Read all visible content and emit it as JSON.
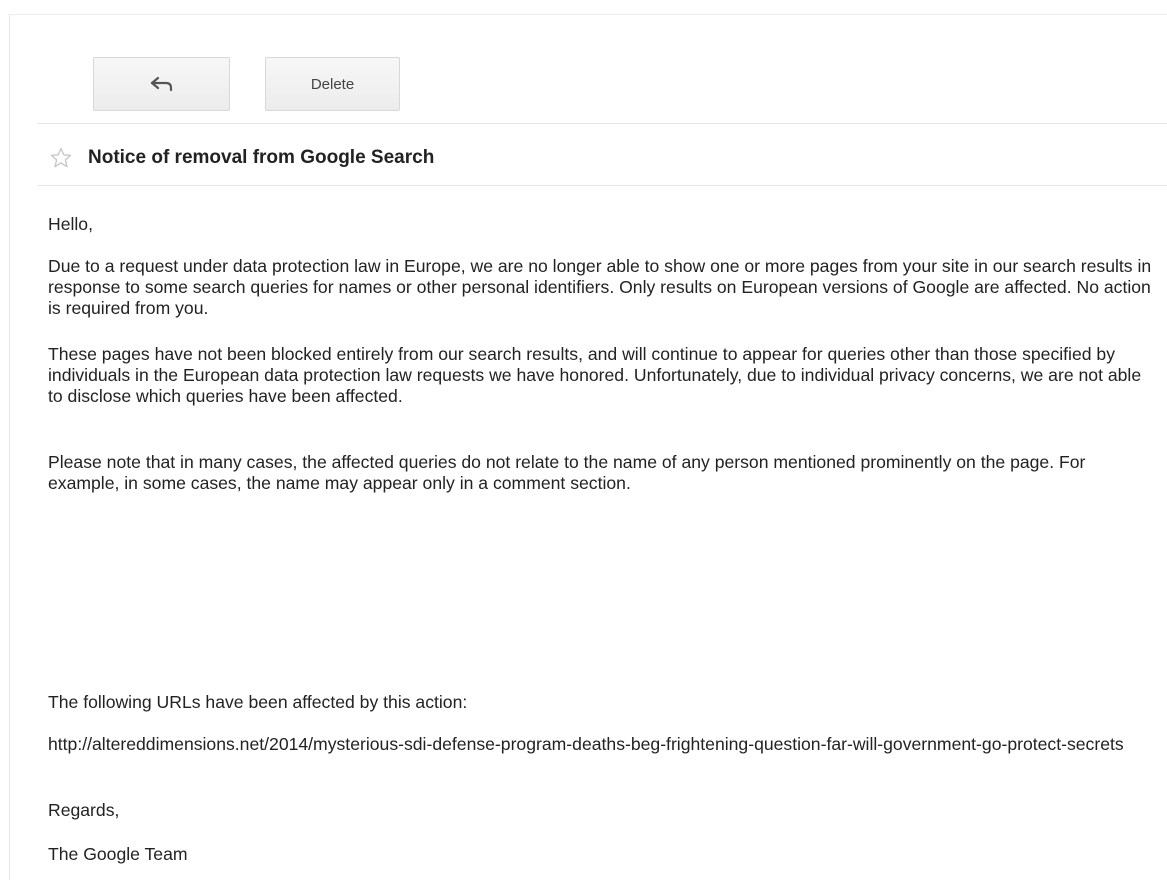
{
  "toolbar": {
    "back_icon": "reply-arrow-icon",
    "delete_label": "Delete"
  },
  "message": {
    "star_icon": "star-outline-icon",
    "subject": "Notice of removal from Google Search",
    "greeting": "Hello,",
    "paragraph_1": "Due to a request under data protection law in Europe, we are no longer able to show one or more pages from your site in our search results in response to some search queries for names or other personal identifiers. Only results on European versions of Google are affected. No action is required from you.",
    "paragraph_2": "These pages have not been blocked entirely from our search results, and will continue to appear for queries other than those specified by individuals in the European data protection law requests we have honored. Unfortunately, due to individual privacy concerns, we are not able to disclose which queries have been affected.",
    "paragraph_3": "Please note that in many cases, the affected queries do not relate to the name of any person mentioned prominently on the page. For example, in some cases, the name may appear only in a comment section.",
    "urls_intro": "The following URLs have been affected by this action:",
    "affected_url": "http://altereddimensions.net/2014/mysterious-sdi-defense-program-deaths-beg-frightening-question-far-will-government-go-protect-secrets",
    "closing": "Regards,",
    "signature": "The Google Team"
  },
  "colors": {
    "text": "#222222",
    "button_bg": "#f2f2f2",
    "button_border": "#d8d8d8",
    "star_outline": "#c8c8c8"
  }
}
